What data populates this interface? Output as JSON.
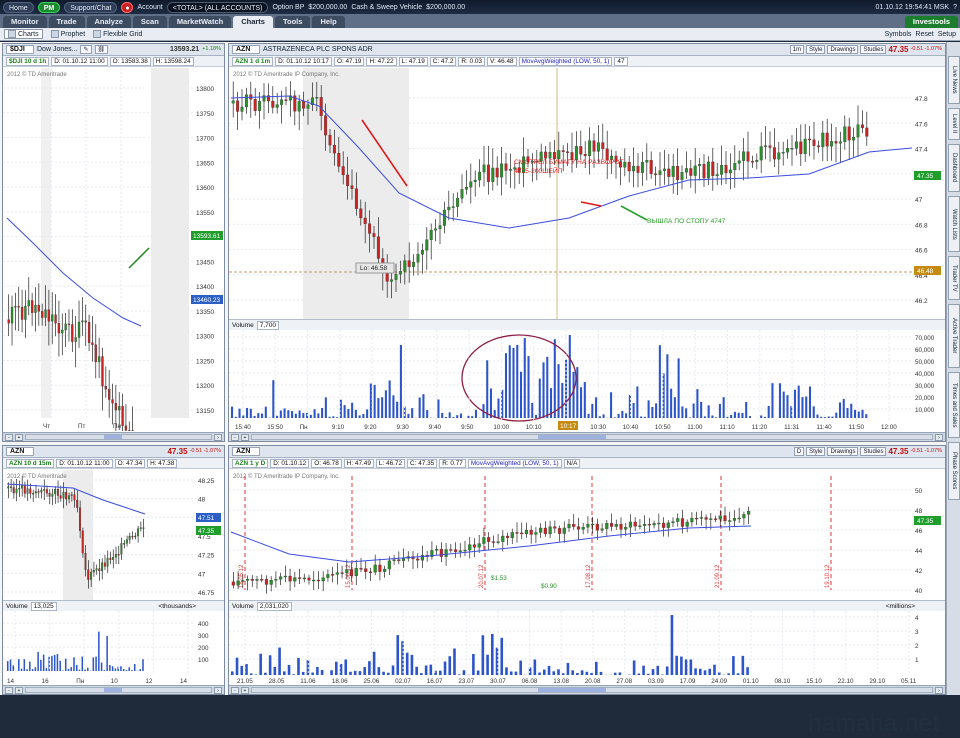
{
  "topbar": {
    "home": "Home",
    "pm": "PM",
    "support": "Support/Chat",
    "account_label": "Account",
    "account_value": "<TOTAL> (ALL ACCOUNTS)",
    "option_bp_label": "Option BP",
    "option_bp_value": "$200,000.00",
    "cash_label": "Cash & Sweep Vehicle",
    "cash_value": "$200,000.00",
    "datetime": "01.10.12 19:54:41 MSK"
  },
  "tabs": [
    "Monitor",
    "Trade",
    "Analyze",
    "Scan",
    "MarketWatch",
    "Charts",
    "Tools",
    "Help"
  ],
  "active_tab": "Charts",
  "brand": "Investools",
  "subbar": {
    "items": [
      "Charts",
      "Prophet",
      "Flexible Grid"
    ],
    "right_buttons": [
      "Symbols",
      "Reset",
      "Setup"
    ]
  },
  "sidebar_tabs": [
    "Live News",
    "Level II",
    "Dashboard",
    "Watch Lists",
    "Trader TV",
    "Active Trader",
    "Times and Sales",
    "Phase Scores"
  ],
  "panels": {
    "djx": {
      "symbol": "$DJI",
      "desc": "Dow Jones...",
      "price": "13593.21",
      "chg": "+1.18%",
      "tf": "$DJI 10 d 1h",
      "info": [
        "D: 01.10.12 11:00",
        "O: 13583.38",
        "H: 13598.24"
      ],
      "copyright": "2012 © TD Ameritrade",
      "yticks": [
        "13800",
        "13750",
        "13700",
        "13650",
        "13600",
        "13550",
        "13500",
        "13450",
        "13400",
        "13350",
        "13300",
        "13250",
        "13200",
        "13150"
      ],
      "xticks": [
        "Чт",
        "Пт",
        "Пн"
      ],
      "price_tag": "13593.61",
      "low_tag": "13460.23"
    },
    "azn_main": {
      "symbol": "AZN",
      "desc": "ASTRAZENECA PLC SPONS ADR",
      "price": "47.35",
      "chg": "-0.51 -1.07%",
      "tf": "AZN 1 d 1m",
      "info": [
        "D: 01.10.12 10:17",
        "O: 47.19",
        "H: 47.22",
        "L: 47.19",
        "C: 47.2",
        "R: 0.03",
        "V: 46.48",
        "MovAvgWeighted (LOW, 50, 1)",
        "47"
      ],
      "copyright": "2012 © TD Ameritrade IP Company, Inc.",
      "period": "1m",
      "style": "Style",
      "drawings": "Drawings",
      "studies": "Studies",
      "yticks": [
        "47.8",
        "47.6",
        "47.4",
        "47.2",
        "47",
        "46.8",
        "46.6",
        "46.4",
        "46.2"
      ],
      "price_tag": "47.35",
      "ref_tag": "46.48",
      "low_label": "Lo: 46.58",
      "annot_red": "СМОТРЕЛ БУМАГУ НА РАЗВОРОТ\n4715-200ШЕЙП",
      "annot_green": "ВЫШЛА ПО СТОПУ 4747",
      "volume_label": "Volume",
      "volume_value": "7,700",
      "vticks": [
        "70,000",
        "60,000",
        "50,000",
        "40,000",
        "30,000",
        "20,000",
        "10,000"
      ],
      "xticks": [
        "15:40",
        "15:50",
        "Пн",
        "9:10",
        "9:20",
        "9:30",
        "9:40",
        "9:50",
        "10:00",
        "10:10",
        "10:20",
        "10:30",
        "10:40",
        "10:50",
        "11:00",
        "11:10",
        "11:20",
        "11:31",
        "11:40",
        "11:50",
        "12:00"
      ],
      "time_tag": "10:17"
    },
    "azn_15m": {
      "symbol": "AZN",
      "tf": "AZN 10 d 15m",
      "price": "47.35",
      "chg": "-0.51 -1.07%",
      "info": [
        "D: 01.10.12 11:00",
        "O: 47.34",
        "H: 47.38"
      ],
      "copyright": "2012 © TD Ameritrade",
      "period": "15m",
      "yticks": [
        "48.25",
        "48",
        "47.75",
        "47.5",
        "47.25",
        "47",
        "46.75"
      ],
      "price_tag": "47.51",
      "tag2": "47.35",
      "volume_label": "Volume",
      "volume_value": "13,025",
      "units": "<thousands>",
      "vticks": [
        "400",
        "300",
        "200",
        "100"
      ],
      "xticks": [
        "14",
        "16",
        "Пн",
        "10",
        "12",
        "14"
      ]
    },
    "azn_1d": {
      "symbol": "AZN",
      "tf": "AZN 1 y D",
      "price": "47.35",
      "chg": "-0.51 -1.07%",
      "desc": "ASTRAZENECA PLC SPONS ADR",
      "info": [
        "D: 01.10.12",
        "O: 46.78",
        "H: 47.49",
        "L: 46.72",
        "C: 47.35",
        "R: 0.77",
        "MovAvgWeighted (LOW, 50, 1)",
        "N/A"
      ],
      "copyright": "2012 © TD Ameritrade IP Company, Inc.",
      "period": "D",
      "style": "Style",
      "drawings": "Drawings",
      "studies": "Studies",
      "yticks": [
        "50",
        "48",
        "46",
        "44",
        "42",
        "40"
      ],
      "price_tag": "47.35",
      "events": [
        "18.05.12",
        "15.06.12",
        "20.07.12",
        "17.08.12",
        "21.09.12",
        "19.10.12"
      ],
      "dividends": [
        "$1.53",
        "$0.90"
      ],
      "volume_label": "Volume",
      "volume_value": "2,031,020",
      "units": "<millions>",
      "vticks": [
        "4",
        "3",
        "2",
        "1"
      ],
      "xticks": [
        "21.05",
        "28.05",
        "11.06",
        "18.06",
        "25.06",
        "02.07",
        "16.07",
        "23.07",
        "30.07",
        "06.08",
        "13.08",
        "20.08",
        "27.08",
        "03.09",
        "17.09",
        "24.09",
        "01.10",
        "08.10",
        "15.10",
        "22.10",
        "29.10",
        "05.11"
      ]
    }
  },
  "watermark": "hamaha.net"
}
